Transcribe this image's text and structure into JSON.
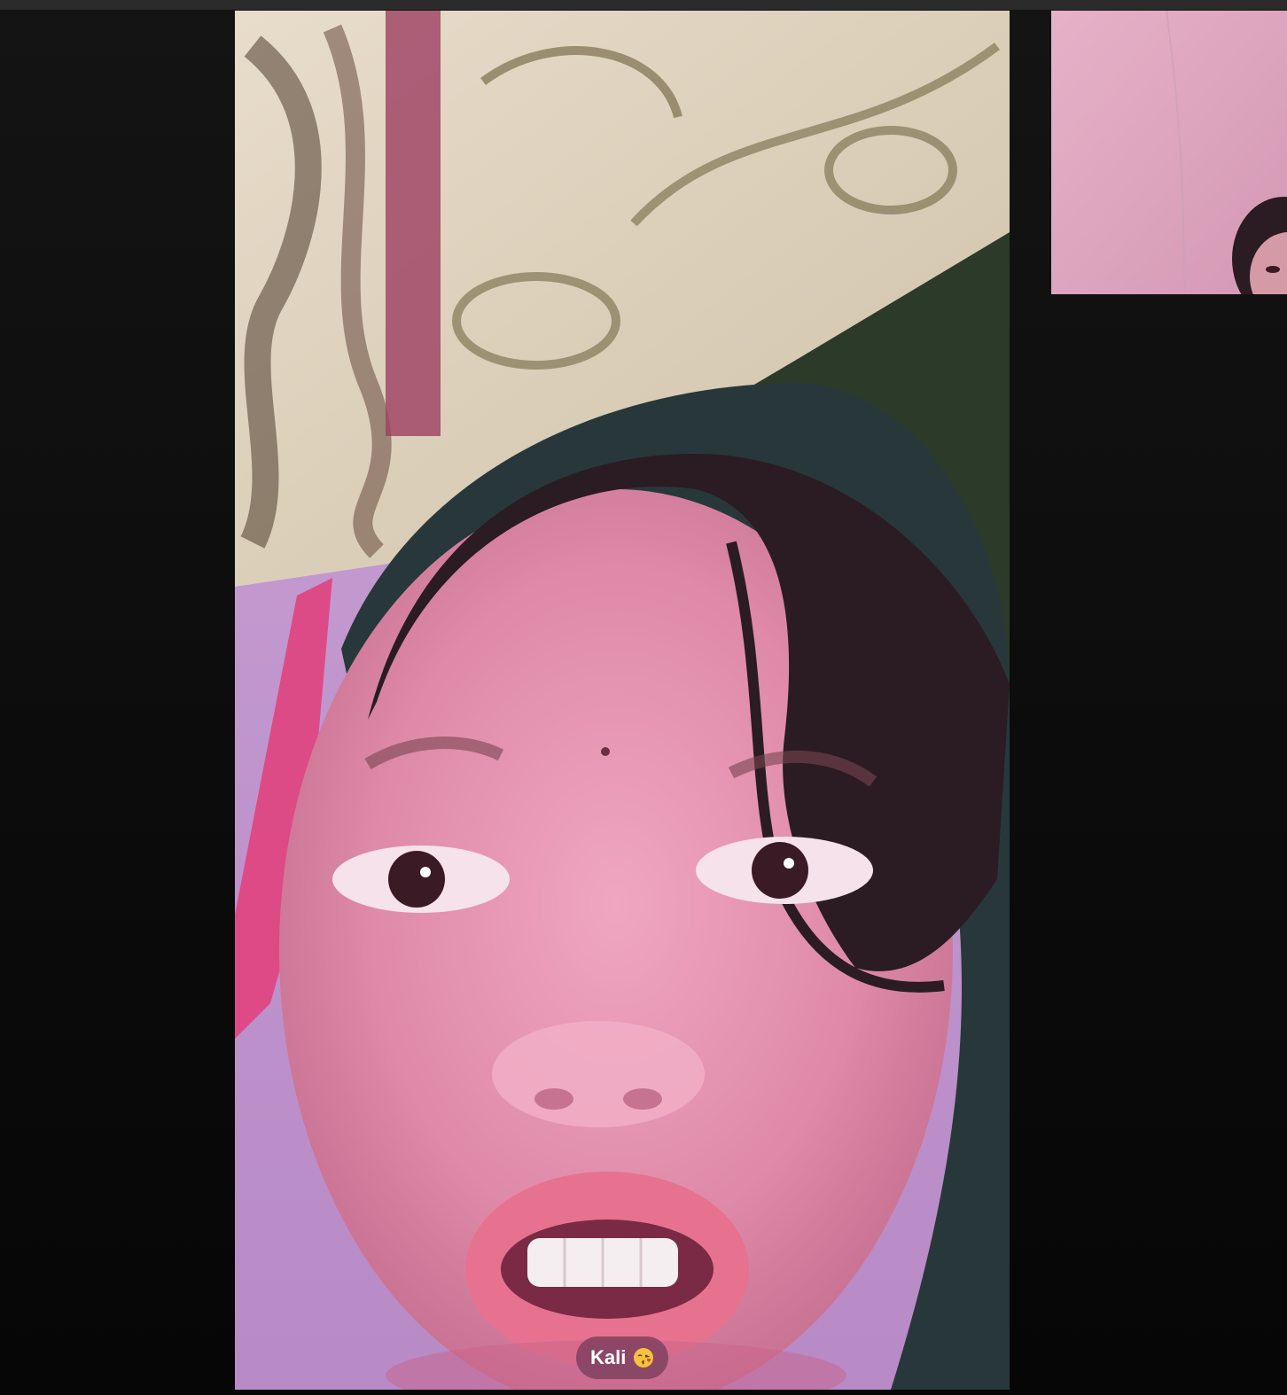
{
  "call": {
    "participant_name": "Kali",
    "participant_emoji": "😘"
  },
  "icons": {
    "emoji": "kissing-face-icon"
  },
  "colors": {
    "background": "#0e0e0e",
    "name_tag_bg": "#7a3c5a",
    "name_tag_text": "#ffffff"
  }
}
